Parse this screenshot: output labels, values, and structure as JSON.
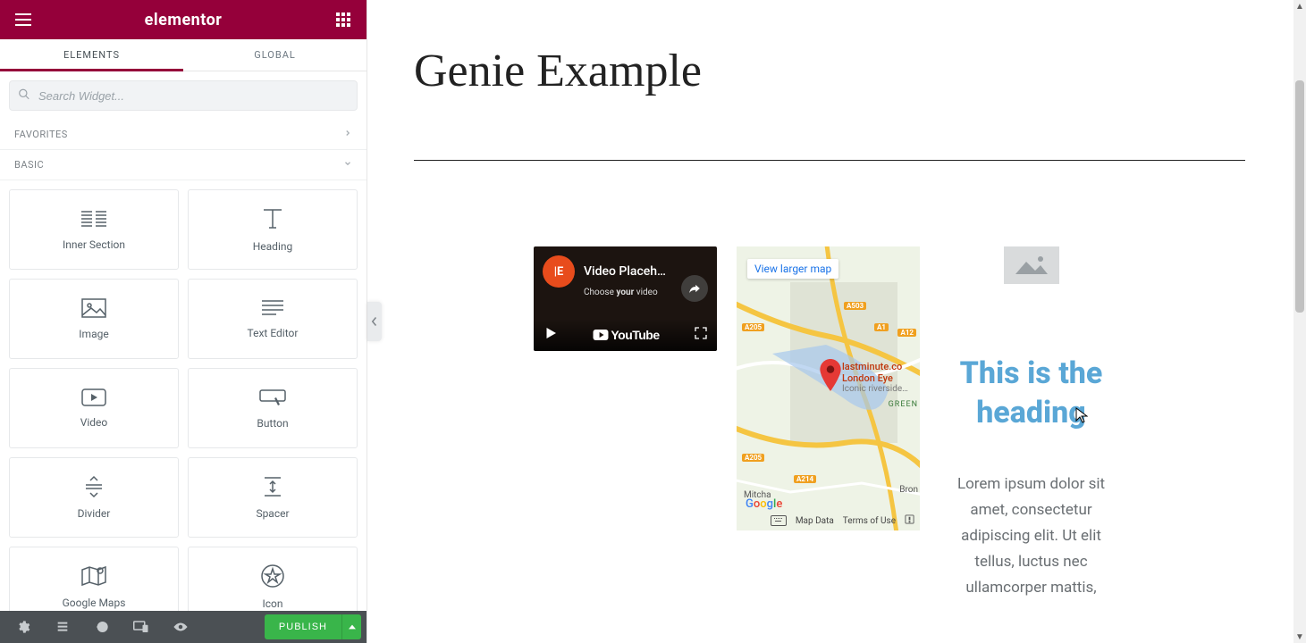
{
  "app": {
    "logo": "elementor"
  },
  "tabs": {
    "elements": "ELEMENTS",
    "global": "GLOBAL"
  },
  "search": {
    "placeholder": "Search Widget..."
  },
  "sections": {
    "favorites": "FAVORITES",
    "basic": "BASIC"
  },
  "widgets": [
    {
      "key": "inner-section",
      "label": "Inner Section"
    },
    {
      "key": "heading",
      "label": "Heading"
    },
    {
      "key": "image",
      "label": "Image"
    },
    {
      "key": "text-editor",
      "label": "Text Editor"
    },
    {
      "key": "video",
      "label": "Video"
    },
    {
      "key": "button",
      "label": "Button"
    },
    {
      "key": "divider",
      "label": "Divider"
    },
    {
      "key": "spacer",
      "label": "Spacer"
    },
    {
      "key": "google-maps",
      "label": "Google Maps"
    },
    {
      "key": "icon",
      "label": "Icon"
    }
  ],
  "footer": {
    "publish": "PUBLISH"
  },
  "canvas": {
    "title": "Genie Example",
    "video": {
      "badge": "|E",
      "title": "Video Placeh…",
      "subtitle_pre": "Choose ",
      "subtitle_bold": "your",
      "subtitle_post": " video",
      "youtube": "YouTube"
    },
    "map": {
      "view_larger": "View larger map",
      "poi_line1": "lastminute.co",
      "poi_line2": "London Eye",
      "poi_line3": "Iconic riverside…",
      "google": "Google",
      "map_data": "Map Data",
      "terms": "Terms of Use",
      "roads": {
        "a205_w": "A205",
        "a503": "A503",
        "a1": "A1",
        "a12": "A12",
        "a205_s": "A205",
        "a214": "A214"
      },
      "places": {
        "mitcham": "Mitcha",
        "green": "GREEN",
        "brom": "Bron"
      }
    },
    "heading": "This is the heading",
    "lorem": "Lorem ipsum dolor sit amet, consectetur adipiscing elit. Ut elit tellus, luctus nec ullamcorper mattis,"
  }
}
